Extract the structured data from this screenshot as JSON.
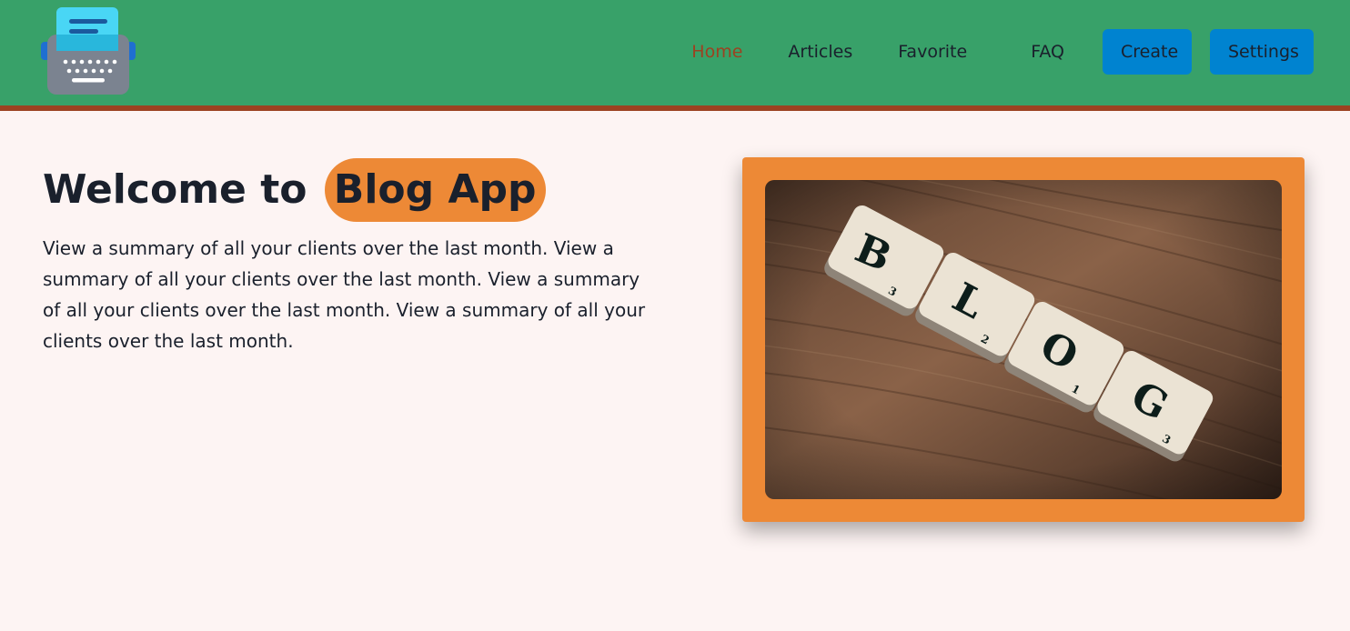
{
  "nav": {
    "links": [
      "Home",
      "Articles",
      "Favorite",
      "FAQ"
    ],
    "active": "Home",
    "create_label": "Create",
    "settings_label": "Settings"
  },
  "hero": {
    "title_prefix": "Welcome to",
    "title_highlight": "Blog App",
    "description": "View a summary of all your clients over the last month. View a summary of all your clients over the last month. View a summary of all your clients over the last month. View a summary of all your clients over the last month.",
    "image_tiles": [
      "B",
      "L",
      "O",
      "G"
    ]
  },
  "colors": {
    "header_bg": "#38a169",
    "header_border": "#9c4221",
    "accent": "#ed8936",
    "button": "#0083d0",
    "page_bg": "#fdf4f3"
  },
  "icons": {
    "logo": "typewriter-icon"
  }
}
